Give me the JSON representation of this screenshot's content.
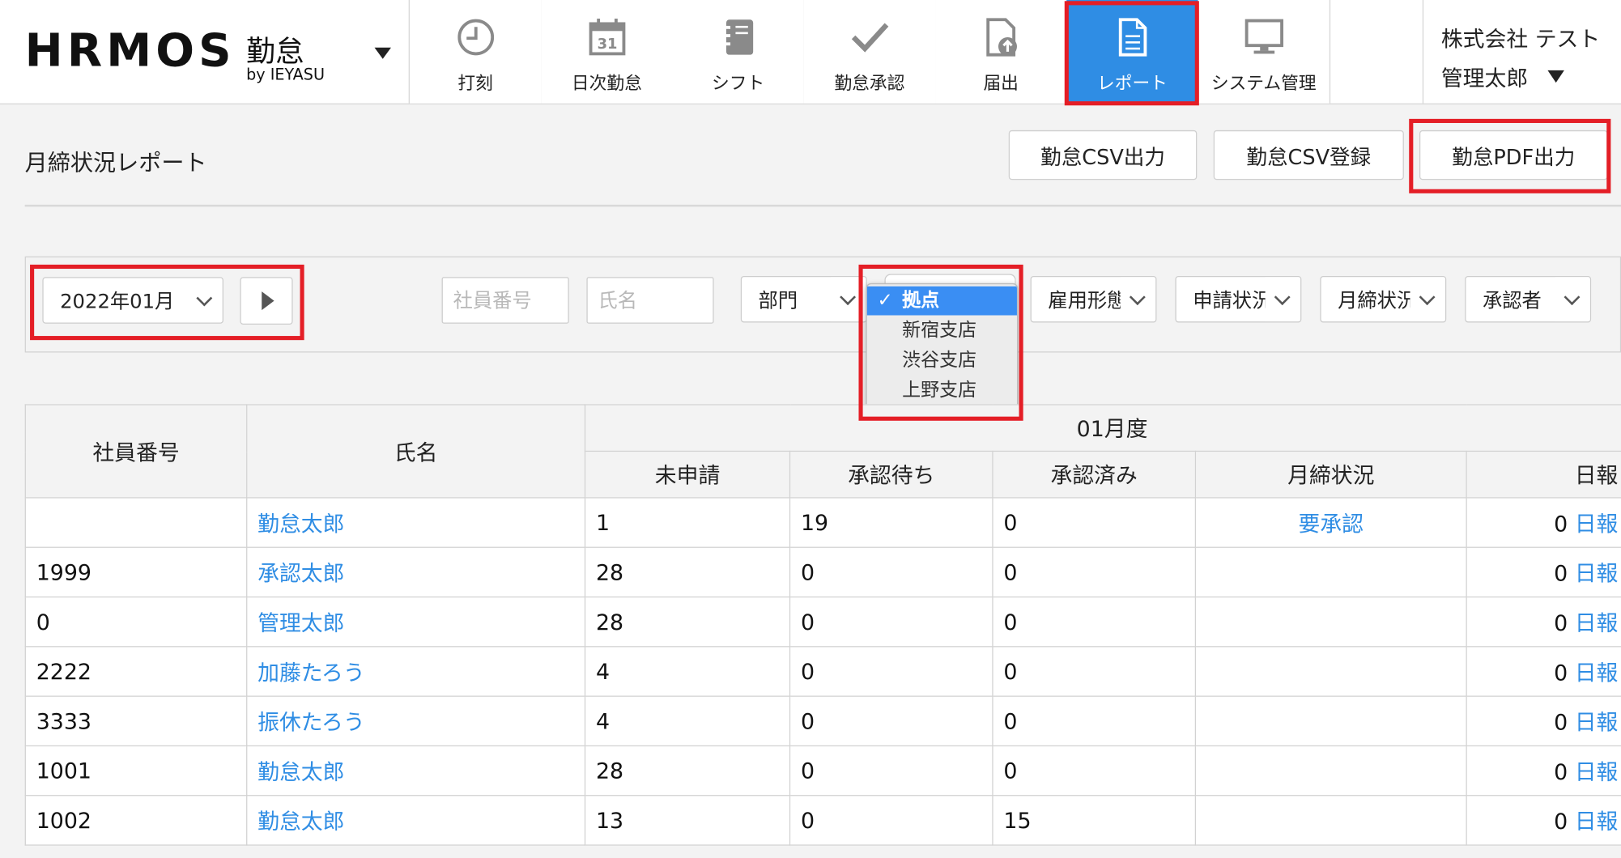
{
  "header": {
    "logo_mark": "HRMOS",
    "logo_product": "勤怠",
    "logo_by": "by IEYASU",
    "nav": [
      {
        "label": "打刻",
        "icon": "clock-icon",
        "active": false
      },
      {
        "label": "日次勤怠",
        "icon": "calendar-icon",
        "active": false
      },
      {
        "label": "シフト",
        "icon": "notebook-icon",
        "active": false
      },
      {
        "label": "勤怠承認",
        "icon": "checkmark-icon",
        "active": false
      },
      {
        "label": "届出",
        "icon": "upload-file-icon",
        "active": false
      },
      {
        "label": "レポート",
        "icon": "document-icon",
        "active": true
      },
      {
        "label": "システム管理",
        "icon": "monitor-icon",
        "active": false
      }
    ],
    "user": {
      "company": "株式会社 テスト",
      "name": "管理太郎"
    }
  },
  "page": {
    "title": "月締状況レポート",
    "buttons": {
      "csv_export": "勤怠CSV出力",
      "csv_import": "勤怠CSV登録",
      "pdf_export": "勤怠PDF出力"
    }
  },
  "filters": {
    "month": "2022年01月",
    "employee_no_placeholder": "社員番号",
    "name_placeholder": "氏名",
    "department": "部門",
    "employment_type": "雇用形態",
    "application_status": "申請状況",
    "closing_status": "月締状況",
    "approver": "承認者"
  },
  "location_dropdown": {
    "options": [
      "拠点",
      "新宿支店",
      "渋谷支店",
      "上野支店"
    ],
    "selected": "拠点",
    "check": "✓"
  },
  "table": {
    "headers": {
      "employee_no": "社員番号",
      "name": "氏名",
      "period": "01月度",
      "unsubmitted": "未申請",
      "pending": "承認待ち",
      "approved": "承認済み",
      "closing_status": "月締状況",
      "daily_report": "日報"
    },
    "rows": [
      {
        "employee_no": "",
        "name": "勤怠太郎",
        "unsubmitted": "1",
        "pending": "19",
        "approved": "0",
        "status": "要承認",
        "daily_count": "0",
        "daily_link": "日報"
      },
      {
        "employee_no": "1999",
        "name": "承認太郎",
        "unsubmitted": "28",
        "pending": "0",
        "approved": "0",
        "status": "",
        "daily_count": "0",
        "daily_link": "日報"
      },
      {
        "employee_no": "0",
        "name": "管理太郎",
        "unsubmitted": "28",
        "pending": "0",
        "approved": "0",
        "status": "",
        "daily_count": "0",
        "daily_link": "日報"
      },
      {
        "employee_no": "2222",
        "name": "加藤たろう",
        "unsubmitted": "4",
        "pending": "0",
        "approved": "0",
        "status": "",
        "daily_count": "0",
        "daily_link": "日報"
      },
      {
        "employee_no": "3333",
        "name": "振休たろう",
        "unsubmitted": "4",
        "pending": "0",
        "approved": "0",
        "status": "",
        "daily_count": "0",
        "daily_link": "日報"
      },
      {
        "employee_no": "1001",
        "name": "勤怠太郎",
        "unsubmitted": "28",
        "pending": "0",
        "approved": "0",
        "status": "",
        "daily_count": "0",
        "daily_link": "日報"
      },
      {
        "employee_no": "1002",
        "name": "勤怠太郎",
        "unsubmitted": "13",
        "pending": "0",
        "approved": "15",
        "status": "",
        "daily_count": "0",
        "daily_link": "日報"
      }
    ]
  },
  "colors": {
    "accent": "#2f8de4",
    "highlight": "#e41e26",
    "dropdown_selected": "#3a8ef3"
  }
}
